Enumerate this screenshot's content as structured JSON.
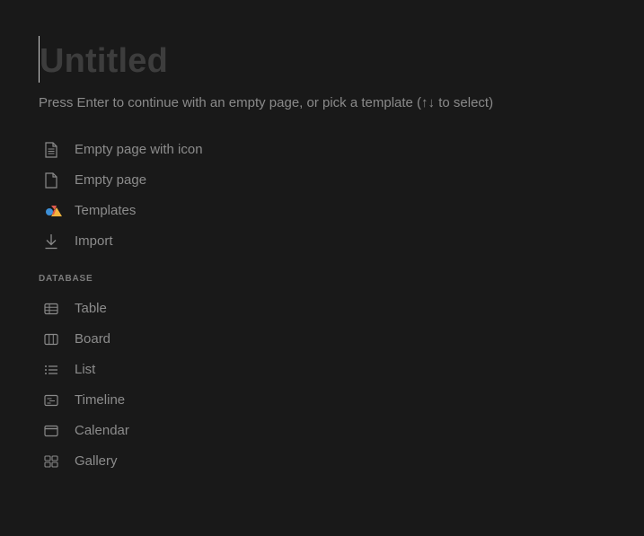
{
  "page": {
    "title": "Untitled",
    "hint": "Press Enter to continue with an empty page, or pick a template (↑↓ to select)"
  },
  "menu": {
    "items": [
      {
        "label": "Empty page with icon",
        "icon": "page-with-lines-icon"
      },
      {
        "label": "Empty page",
        "icon": "blank-page-icon"
      },
      {
        "label": "Templates",
        "icon": "templates-shapes-icon"
      },
      {
        "label": "Import",
        "icon": "download-arrow-icon"
      }
    ]
  },
  "database": {
    "section_label": "DATABASE",
    "items": [
      {
        "label": "Table",
        "icon": "table-icon"
      },
      {
        "label": "Board",
        "icon": "board-columns-icon"
      },
      {
        "label": "List",
        "icon": "list-icon"
      },
      {
        "label": "Timeline",
        "icon": "timeline-icon"
      },
      {
        "label": "Calendar",
        "icon": "calendar-icon"
      },
      {
        "label": "Gallery",
        "icon": "gallery-grid-icon"
      }
    ]
  },
  "colors": {
    "background": "#191919",
    "title": "#3d3d3d",
    "text": "#8c8c8c",
    "icon": "#8a8a8a",
    "templates_red": "#e05a4d",
    "templates_blue": "#3d8fd6",
    "templates_yellow": "#f3b33d"
  }
}
